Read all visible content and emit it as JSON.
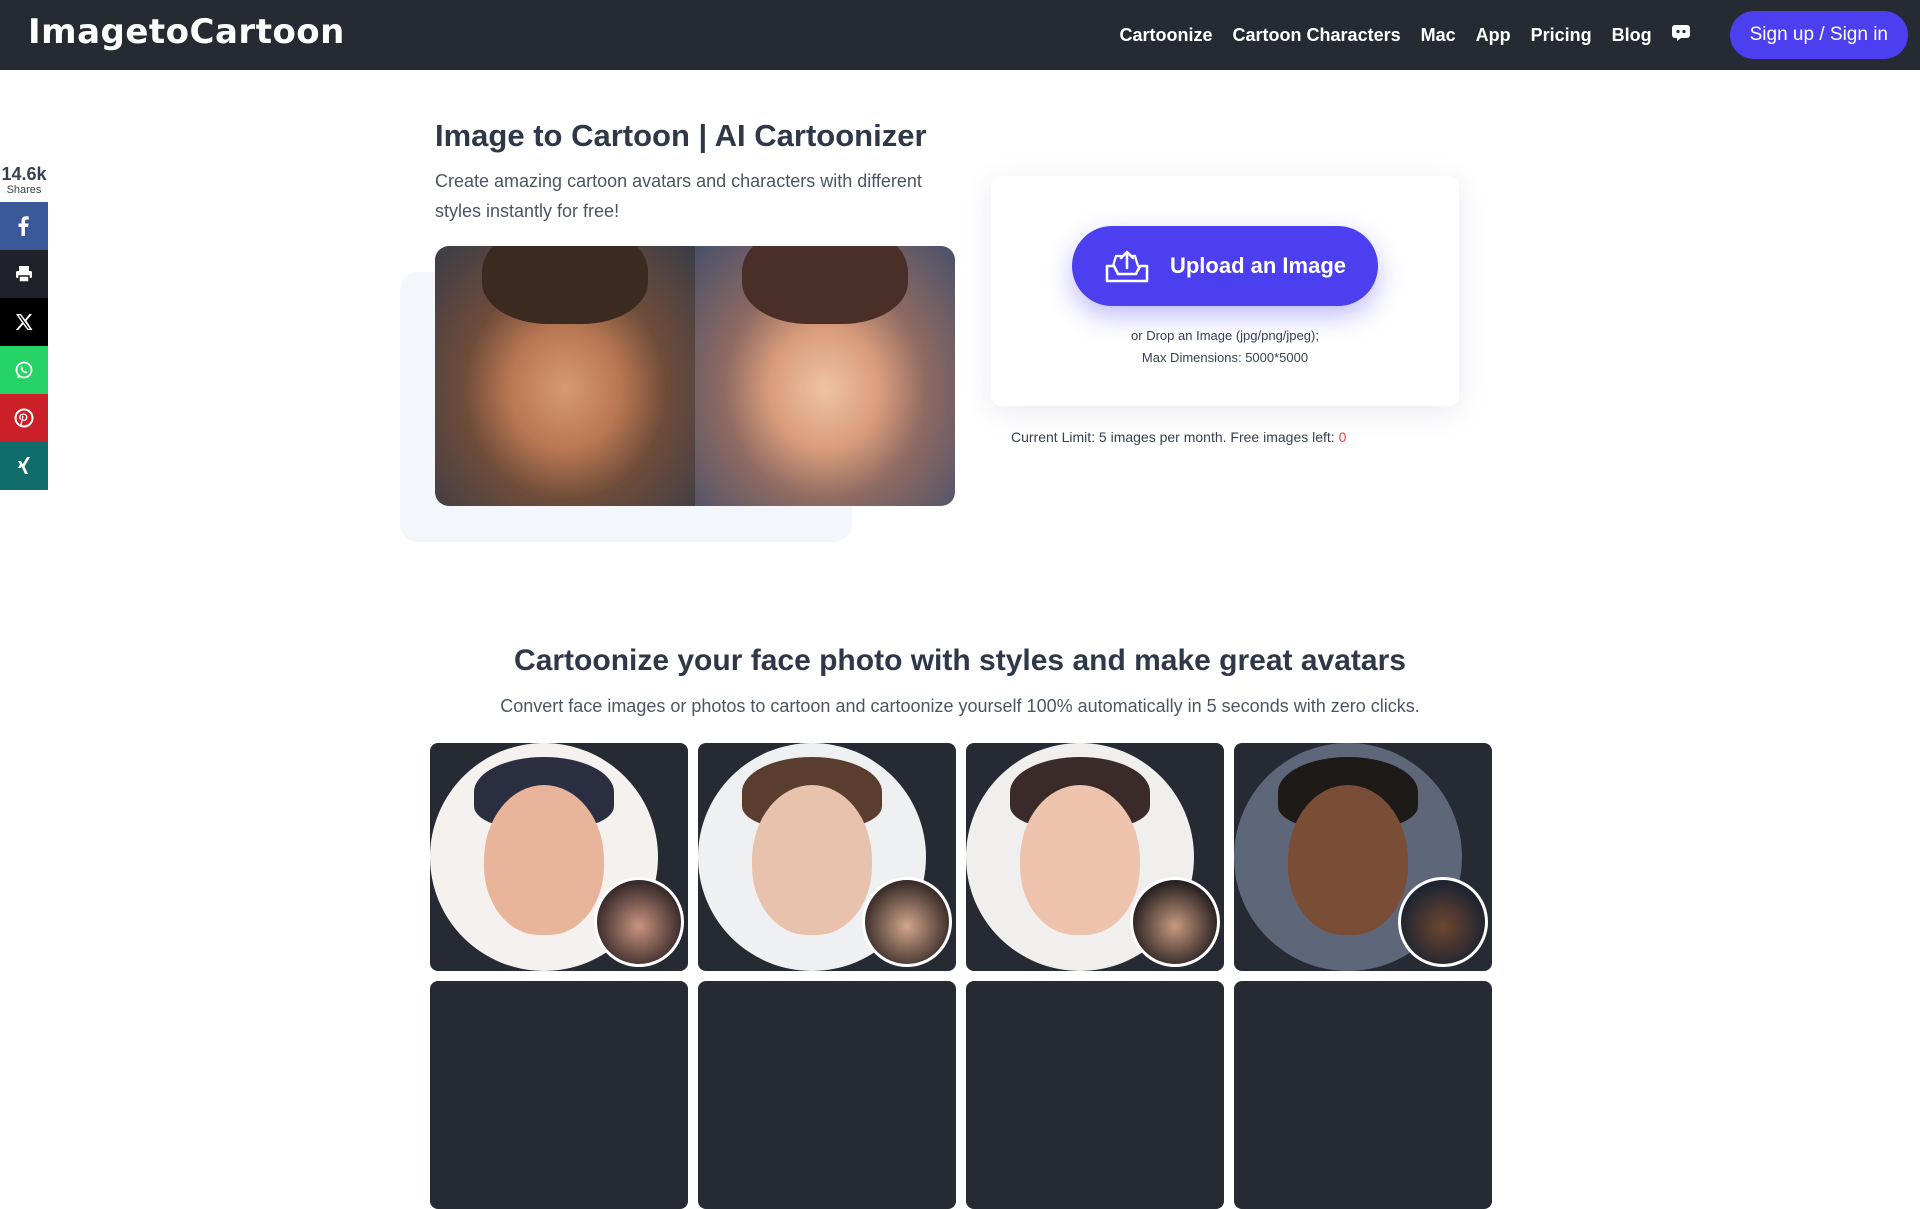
{
  "header": {
    "logo": "ImagetoCartoon",
    "nav": [
      "Cartoonize",
      "Cartoon Characters",
      "Mac",
      "App",
      "Pricing",
      "Blog"
    ],
    "signup_label": "Sign up / Sign in"
  },
  "share": {
    "count": "14.6k",
    "label": "Shares",
    "buttons": [
      {
        "name": "facebook",
        "color": "#3b5998"
      },
      {
        "name": "print",
        "color": "#1f2329"
      },
      {
        "name": "x",
        "color": "#000000"
      },
      {
        "name": "whatsapp",
        "color": "#25d366"
      },
      {
        "name": "pinterest",
        "color": "#cb2027"
      },
      {
        "name": "xing",
        "color": "#0f6c6a"
      }
    ]
  },
  "hero": {
    "title": "Image to Cartoon | AI Cartoonizer",
    "subtitle": "Create amazing cartoon avatars and characters with different styles instantly for free!"
  },
  "upload": {
    "button_label": "Upload an Image",
    "hint_line1": "or Drop an Image (jpg/png/jpeg);",
    "hint_line2": "Max Dimensions: 5000*5000",
    "limit_text": "Current Limit: 5 images per month. Free images left: ",
    "limit_count": "0"
  },
  "styles_section": {
    "title": "Cartoonize your face photo with styles and make great avatars",
    "subtitle": "Convert face images or photos to cartoon and cartoonize yourself 100% automatically in 5 seconds with zero clicks."
  },
  "colors": {
    "accent": "#4b3ff0",
    "header_bg": "#252a33",
    "card_bg": "#262a33",
    "limit_red": "#ef4444"
  }
}
